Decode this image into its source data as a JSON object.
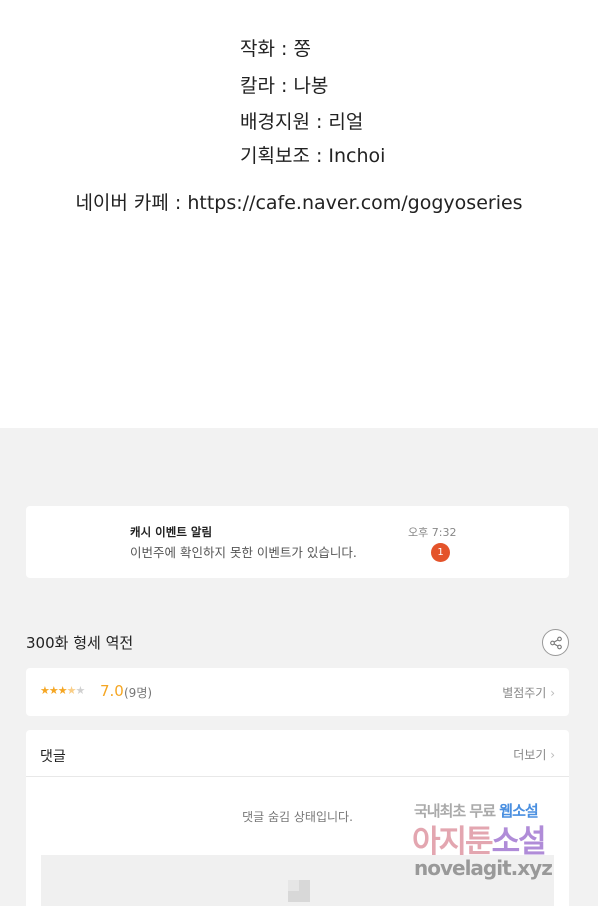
{
  "credits": {
    "lines": [
      "작화 : 쫑",
      "칼라 : 나봉",
      "배경지원 : 리얼",
      "기획보조 : Inchoi"
    ],
    "cafe": "네이버 카페 : https://cafe.naver.com/gogyoseries"
  },
  "notice": {
    "title": "캐시 이벤트 알림",
    "message": "이번주에 확인하지 못한 이벤트가 있습니다.",
    "time": "오후 7:32",
    "badge": "1"
  },
  "episode": {
    "title": "300화 형세 역전"
  },
  "rating": {
    "stars_filled": 3.5,
    "stars_total": 5,
    "score": "7.0",
    "count": "(9명)",
    "rate_link": "별점주기"
  },
  "comments": {
    "title": "댓글",
    "more": "더보기",
    "hidden_message": "댓글 숨김 상태입니다."
  },
  "watermark": {
    "top": "국내최초 무료",
    "top_accent": "웹소설",
    "mid": "아지툰",
    "mid_accent": "소설",
    "bottom": "novelagit.xyz"
  },
  "colors": {
    "star": "#f5a623",
    "badge": "#e4532a",
    "background": "#f2f2f2"
  },
  "icons": {
    "share": "share-icon",
    "chevron": "chevron-right-icon",
    "image_placeholder": "image-placeholder-icon"
  }
}
